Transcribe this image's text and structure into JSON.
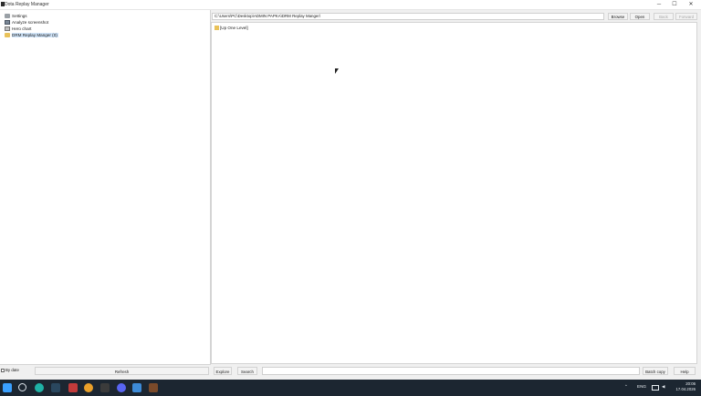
{
  "window": {
    "title": "Dota Replay Manager",
    "controls": {
      "minimize": "─",
      "maximize": "☐",
      "close": "✕"
    }
  },
  "tree": {
    "items": [
      {
        "label": "Settings",
        "icon": "gear-icon"
      },
      {
        "label": "Analyze screenshot",
        "icon": "image-icon"
      },
      {
        "label": "Hero chart",
        "icon": "chart-icon"
      },
      {
        "label": "DRM Replay Manger (0)",
        "icon": "folder-icon"
      }
    ]
  },
  "toolbar": {
    "path": "C:\\Users\\PC\\Desktop\\ADMIN PAPKA\\DRM Replay Manger\\",
    "browse": "Browse",
    "open": "Open",
    "back": "Back",
    "forward": "Forward"
  },
  "filelist": {
    "items": [
      {
        "label": "[Up One Level]",
        "icon": "folder-up-icon"
      }
    ]
  },
  "bottom": {
    "by_date": "By date",
    "refresh": "Refresh",
    "explore": "Explore",
    "search": "Search",
    "batch_copy": "Batch copy",
    "help": "Help"
  },
  "taskbar": {
    "lang": "ENG",
    "time": "20:06",
    "date": "17.04.2026"
  },
  "colors": {
    "taskbar": "#1c2631",
    "selection": "#cfe3f7",
    "folder": "#e9c25a"
  }
}
